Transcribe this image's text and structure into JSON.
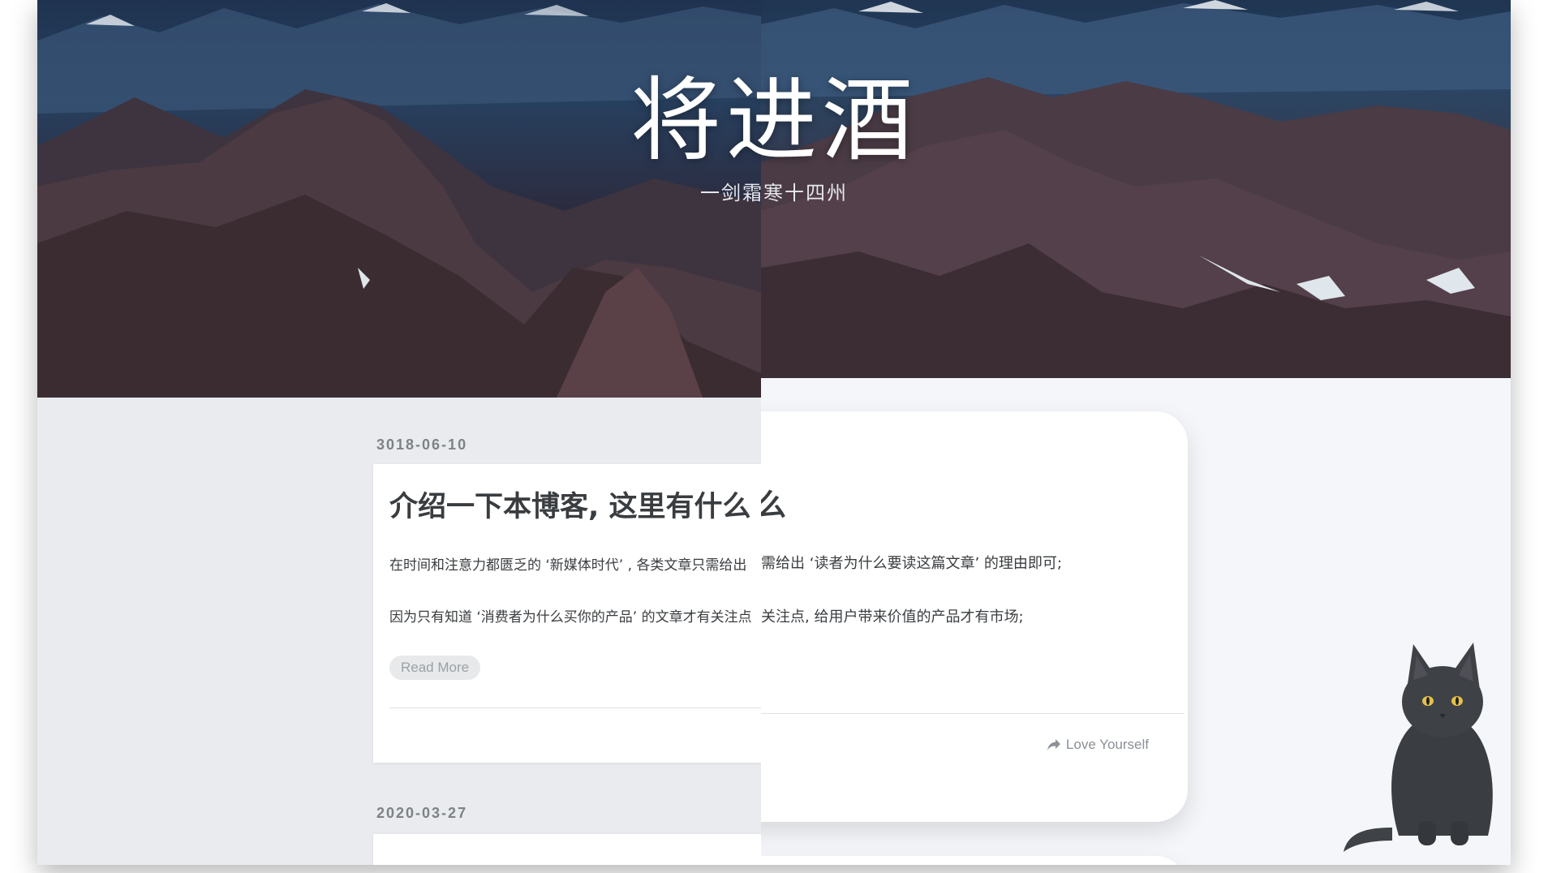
{
  "hero": {
    "title": "将进酒",
    "subtitle": "一剑霜寒十四州"
  },
  "old_theme": {
    "posts": [
      {
        "date": "3018-06-10",
        "title": "介绍一下本博客, 这里有什么",
        "paragraphs": [
          "在时间和注意力都匮乏的 ‘新媒体时代’ , 各类文章只需给出",
          "因为只有知道 ‘消费者为什么买你的产品’ 的文章才有关注点"
        ],
        "read_more": "Read More"
      },
      {
        "date": "2020-03-27"
      }
    ]
  },
  "new_theme": {
    "post": {
      "title_tail": "么",
      "paragraphs": [
        "需给出 ‘读者为什么要读这篇文章’ 的理由即可;",
        "关注点, 给用户带来价值的产品才有市场;"
      ],
      "footer_link": "Love Yourself",
      "footer_icon": "share-arrow-icon"
    }
  },
  "mascot": {
    "icon": "black-cat-icon"
  },
  "colors": {
    "left_background": "#e9ebee",
    "right_background": "#f4f6f9",
    "text": "#3a3d40",
    "muted": "#8b9197"
  }
}
